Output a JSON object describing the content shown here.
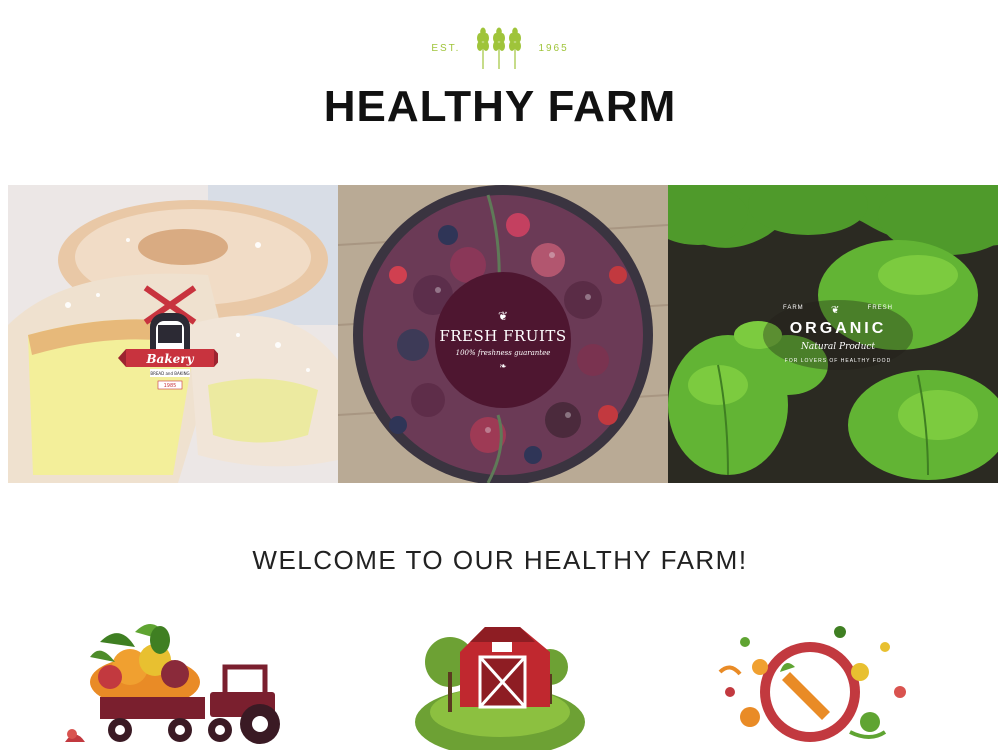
{
  "header": {
    "est_label": "EST.",
    "est_year": "1965",
    "title": "HEALTHY FARM"
  },
  "banner": {
    "bakery": {
      "badge_title": "Bakery",
      "badge_sub": "BREAD and BAKING",
      "badge_year": "1985"
    },
    "fruits": {
      "badge_title": "FRESH FRUITS",
      "badge_sub": "100% freshness guarantee"
    },
    "organic": {
      "farm_left": "FARM",
      "farm_right": "FRESH",
      "badge_title": "ORGANIC",
      "badge_sub": "Natural Product",
      "badge_tag": "FOR LOVERS OF HEALTHY FOOD"
    }
  },
  "welcome": {
    "heading": "WELCOME TO OUR HEALTHY FARM!"
  },
  "features": [
    {
      "icon": "tractor-harvest-icon"
    },
    {
      "icon": "red-barn-icon"
    },
    {
      "icon": "vegetable-plate-icon"
    }
  ],
  "colors": {
    "accent_green": "#9fc43a",
    "fruit_badge": "#5a1a35",
    "bakery_red": "#c8333e"
  }
}
